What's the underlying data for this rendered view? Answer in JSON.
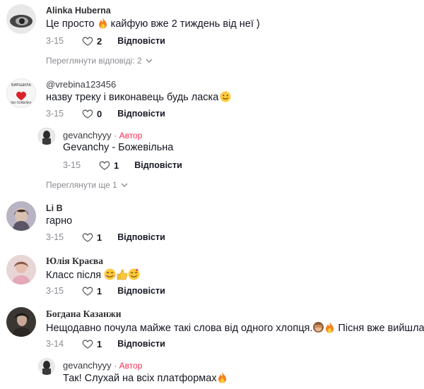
{
  "colors": {
    "author_badge": "#fe2c55",
    "muted": "#8a8b91",
    "text": "#161823"
  },
  "icons": {
    "like": "heart-outline-icon",
    "expand": "chevron-down-icon",
    "fire": "fire-emoji",
    "smile": "smiling-face-emoji"
  },
  "comments": [
    {
      "user": "Alinka Huberna",
      "text_pre": "Це просто ",
      "text_post": " кайфую вже 2 тиждень від неї )",
      "date": "3-15",
      "likes": "2",
      "reply_label": "Відповісти",
      "view_replies": "Переглянути відповіді: 2"
    },
    {
      "user": "@vrebina123456",
      "text": "назву треку і виконавець будь ласка",
      "date": "3-15",
      "likes": "0",
      "reply_label": "Відповісти",
      "view_more": "Переглянути ще 1",
      "reply": {
        "user": "gevanchyyy",
        "author_badge": "· Автор",
        "text": "Gevanchy - Божевільна",
        "date": "3-15",
        "likes": "1",
        "reply_label": "Відповісти"
      }
    },
    {
      "user": "Li B",
      "text": "гарно",
      "date": "3-15",
      "likes": "1",
      "reply_label": "Відповісти"
    },
    {
      "user": "Юлія Краєва",
      "text": "Класс після",
      "date": "3-15",
      "likes": "1",
      "reply_label": "Відповісти"
    },
    {
      "user": "Богдана Казанжи",
      "text_pre": "Нещодавно почула майже такі слова від одного хлопця.",
      "text_post": " Пісня вже вийшла?",
      "date": "3-14",
      "likes": "1",
      "reply_label": "Відповісти",
      "reply": {
        "user": "gevanchyyy",
        "author_badge": "· Автор",
        "text": "Так! Слухай на всіх платформах"
      }
    }
  ]
}
